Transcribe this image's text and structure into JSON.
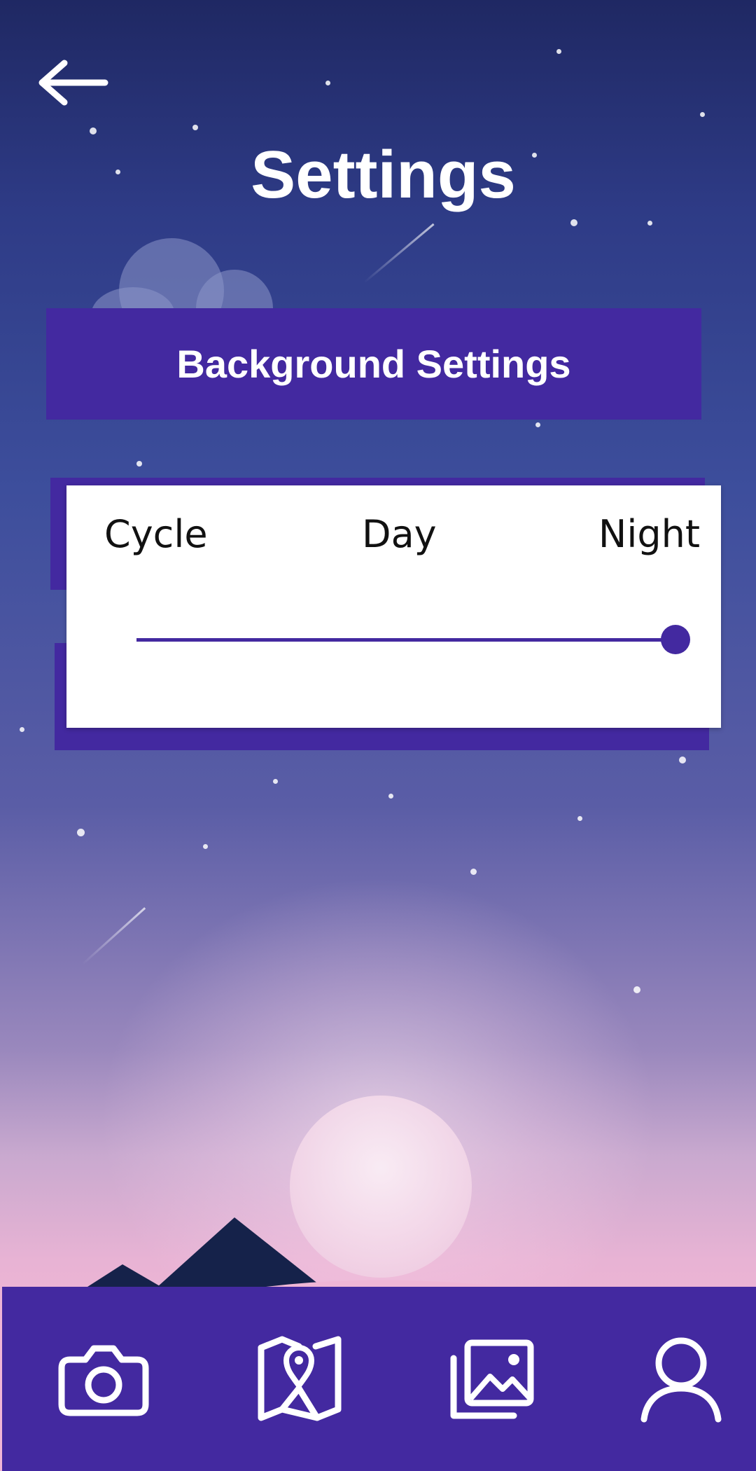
{
  "header": {
    "title": "Settings",
    "back_icon": "arrow-left-icon"
  },
  "background_settings": {
    "title": "Background Settings",
    "modes": [
      "Cycle",
      "Day",
      "Night"
    ],
    "selected_mode": "Night",
    "slider_value": 1.0
  },
  "bottom_nav": {
    "items": [
      {
        "icon": "camera-icon"
      },
      {
        "icon": "map-icon"
      },
      {
        "icon": "gallery-icon"
      },
      {
        "icon": "profile-icon"
      }
    ]
  },
  "colors": {
    "accent": "#4329a0",
    "card": "#ffffff",
    "text_on_accent": "#ffffff"
  }
}
